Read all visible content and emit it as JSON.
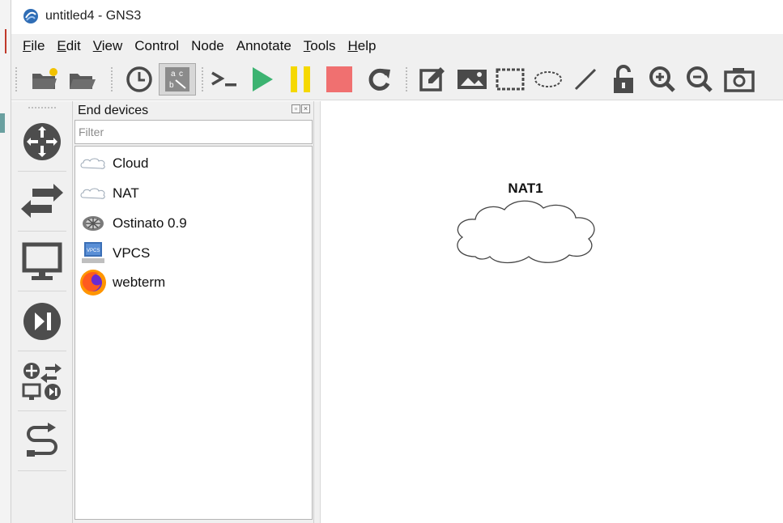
{
  "window": {
    "title": "untitled4 - GNS3",
    "app_icon": "gns3-logo-icon"
  },
  "menubar": {
    "items": [
      {
        "label": "File",
        "mnemonic": "F",
        "rest": "ile"
      },
      {
        "label": "Edit",
        "mnemonic": "E",
        "rest": "dit"
      },
      {
        "label": "View",
        "mnemonic": "V",
        "rest": "iew"
      },
      {
        "label": "Control",
        "mnemonic": "",
        "rest": "Control"
      },
      {
        "label": "Node",
        "mnemonic": "",
        "rest": "Node"
      },
      {
        "label": "Annotate",
        "mnemonic": "",
        "rest": "Annotate"
      },
      {
        "label": "Tools",
        "mnemonic": "T",
        "rest": "ools"
      },
      {
        "label": "Help",
        "mnemonic": "H",
        "rest": "elp"
      }
    ]
  },
  "toolbar": {
    "buttons": [
      {
        "name": "new-project",
        "icon": "new-folder-icon"
      },
      {
        "name": "open-project",
        "icon": "open-folder-icon"
      },
      {
        "name": "snapshot",
        "icon": "clock-icon"
      },
      {
        "name": "show-interface-labels",
        "icon": "interface-labels-icon",
        "active": true
      },
      {
        "name": "console-all",
        "icon": "terminal-icon"
      },
      {
        "name": "start-all",
        "icon": "play-icon"
      },
      {
        "name": "suspend-all",
        "icon": "pause-icon"
      },
      {
        "name": "stop-all",
        "icon": "stop-icon"
      },
      {
        "name": "reload-all",
        "icon": "reload-icon"
      },
      {
        "name": "add-note",
        "icon": "edit-note-icon"
      },
      {
        "name": "insert-picture",
        "icon": "picture-icon"
      },
      {
        "name": "draw-rectangle",
        "icon": "rectangle-icon"
      },
      {
        "name": "draw-ellipse",
        "icon": "ellipse-icon"
      },
      {
        "name": "draw-line",
        "icon": "line-icon"
      },
      {
        "name": "lock-items",
        "icon": "unlock-icon"
      },
      {
        "name": "zoom-in",
        "icon": "zoom-in-icon"
      },
      {
        "name": "zoom-out",
        "icon": "zoom-out-icon"
      },
      {
        "name": "screenshot",
        "icon": "camera-icon"
      }
    ]
  },
  "devbar": {
    "buttons": [
      {
        "name": "routers",
        "icon": "router-icon"
      },
      {
        "name": "switches",
        "icon": "switch-icon"
      },
      {
        "name": "end-devices",
        "icon": "monitor-icon"
      },
      {
        "name": "security-devices",
        "icon": "security-device-icon"
      },
      {
        "name": "all-devices",
        "icon": "all-devices-icon"
      },
      {
        "name": "add-link",
        "icon": "cable-icon"
      }
    ]
  },
  "dock": {
    "title": "End devices",
    "filter_placeholder": "Filter",
    "devices": [
      {
        "label": "Cloud",
        "icon": "cloud-icon"
      },
      {
        "label": "NAT",
        "icon": "cloud-icon"
      },
      {
        "label": "Ostinato 0.9",
        "icon": "ostinato-icon"
      },
      {
        "label": "VPCS",
        "icon": "vpcs-icon"
      },
      {
        "label": "webterm",
        "icon": "firefox-icon"
      }
    ]
  },
  "canvas": {
    "nodes": [
      {
        "label": "NAT1",
        "icon": "cloud-icon"
      }
    ]
  },
  "colors": {
    "play": "#3cb371",
    "pause": "#f5d800",
    "stop": "#f07070",
    "icon_dark": "#4a4a4a",
    "panel_bg": "#f0f0f0"
  }
}
